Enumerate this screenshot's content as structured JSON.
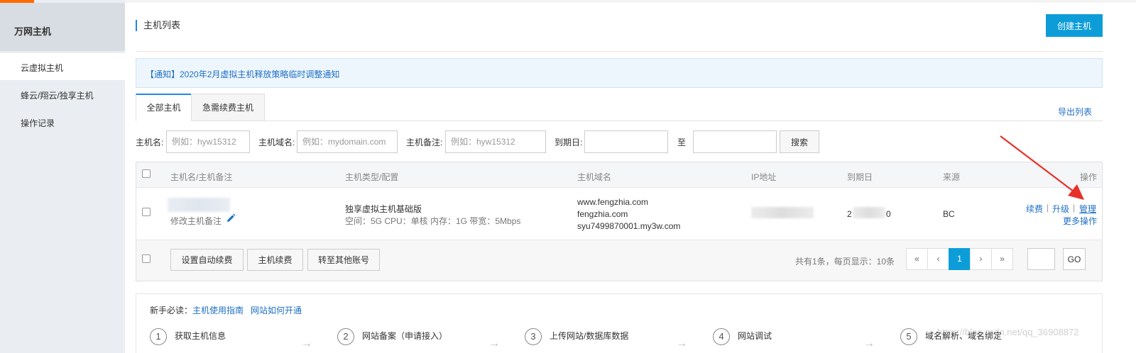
{
  "sidebar": {
    "title": "万网主机",
    "items": [
      {
        "label": "云虚拟主机",
        "active": true
      },
      {
        "label": "蜂云/翔云/独享主机",
        "active": false
      },
      {
        "label": "操作记录",
        "active": false
      }
    ]
  },
  "header": {
    "title": "主机列表",
    "create_button": "创建主机"
  },
  "notice": "【通知】2020年2月虚拟主机释放策略临时调整通知",
  "tabs": [
    {
      "label": "全部主机",
      "active": true
    },
    {
      "label": "急需续费主机",
      "active": false
    }
  ],
  "export_link": "导出列表",
  "filters": {
    "name_label": "主机名:",
    "name_placeholder": "例如：hyw15312",
    "domain_label": "主机域名:",
    "domain_placeholder": "例如：mydomain.com",
    "remark_label": "主机备注:",
    "remark_placeholder": "例如：hyw15312",
    "expire_label": "到期日:",
    "to_label": "至",
    "search_button": "搜索"
  },
  "table": {
    "columns": [
      "主机名/主机备注",
      "主机类型/配置",
      "主机域名",
      "IP地址",
      "到期日",
      "来源",
      "操作"
    ],
    "rows": [
      {
        "remark_link": "修改主机备注",
        "type": "独享虚拟主机基础版",
        "config": "空间：5G CPU：单核 内存：1G 带宽：5Mbps",
        "domains": [
          "www.fengzhia.com",
          "fengzhia.com",
          "syu7499870001.my3w.com"
        ],
        "expire_start": "2",
        "expire_end": "0",
        "source": "BC",
        "actions": {
          "renew": "续费",
          "sep1": "|",
          "upgrade": "升级",
          "sep2": "|",
          "manage": "管理",
          "more": "更多操作"
        }
      }
    ]
  },
  "footer": {
    "auto_renew_button": "设置自动续费",
    "renew_button": "主机续费",
    "transfer_button": "转至其他账号",
    "summary": "共有1条，每页显示：10条",
    "pager": {
      "first": "«",
      "prev": "‹",
      "current": "1",
      "next": "›",
      "last": "»"
    },
    "go_button": "GO"
  },
  "guide": {
    "intro": "新手必读：",
    "links": [
      "主机使用指南",
      "网站如何开通"
    ],
    "steps": [
      {
        "num": "1",
        "label": "获取主机信息"
      },
      {
        "num": "2",
        "label": "网站备案（申请接入）"
      },
      {
        "num": "3",
        "label": "上传网站/数据库数据"
      },
      {
        "num": "4",
        "label": "网站调试"
      },
      {
        "num": "5",
        "label": "域名解析、域名绑定"
      }
    ],
    "arrow": "→"
  },
  "watermark": "https://blog.csdn.net/qq_36908872",
  "colors": {
    "accent": "#0c9dd8",
    "link": "#1e6fc4",
    "annotation_arrow": "#e8302a"
  }
}
